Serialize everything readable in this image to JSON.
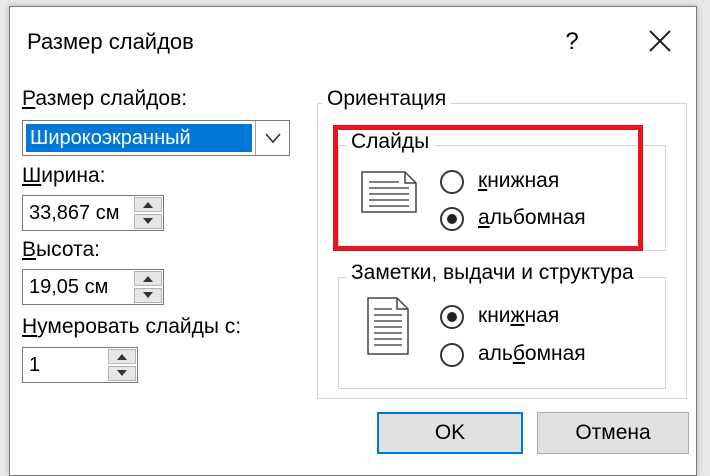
{
  "dialog": {
    "title": "Размер слайдов",
    "help_label": "?",
    "close_icon": "close-icon"
  },
  "left": {
    "size_label_u": "Р",
    "size_label_rest": "азмер слайдов:",
    "size_value": "Широкоэкранный",
    "width_label_u": "Ш",
    "width_label_rest": "ирина:",
    "width_value": "33,867 см",
    "height_label_u": "В",
    "height_label_rest": "ысота:",
    "height_value": "19,05 см",
    "number_label_u": "Н",
    "number_label_rest": "умеровать слайды с:",
    "number_value": "1"
  },
  "orientation": {
    "title": "Ориентация",
    "slides": {
      "title": "Слайды",
      "portrait_u": "к",
      "portrait_rest": "нижная",
      "landscape_u": "а",
      "landscape_rest": "льбомная",
      "selected": "landscape"
    },
    "notes": {
      "title": "Заметки, выдачи и структура",
      "portrait_pre": "кни",
      "portrait_u": "ж",
      "portrait_rest": "ная",
      "landscape_pre": "аль",
      "landscape_u": "б",
      "landscape_rest": "омная",
      "selected": "portrait"
    }
  },
  "buttons": {
    "ok": "OK",
    "cancel": "Отмена"
  },
  "colors": {
    "accent": "#0078d7",
    "highlight": "#e8141e"
  }
}
